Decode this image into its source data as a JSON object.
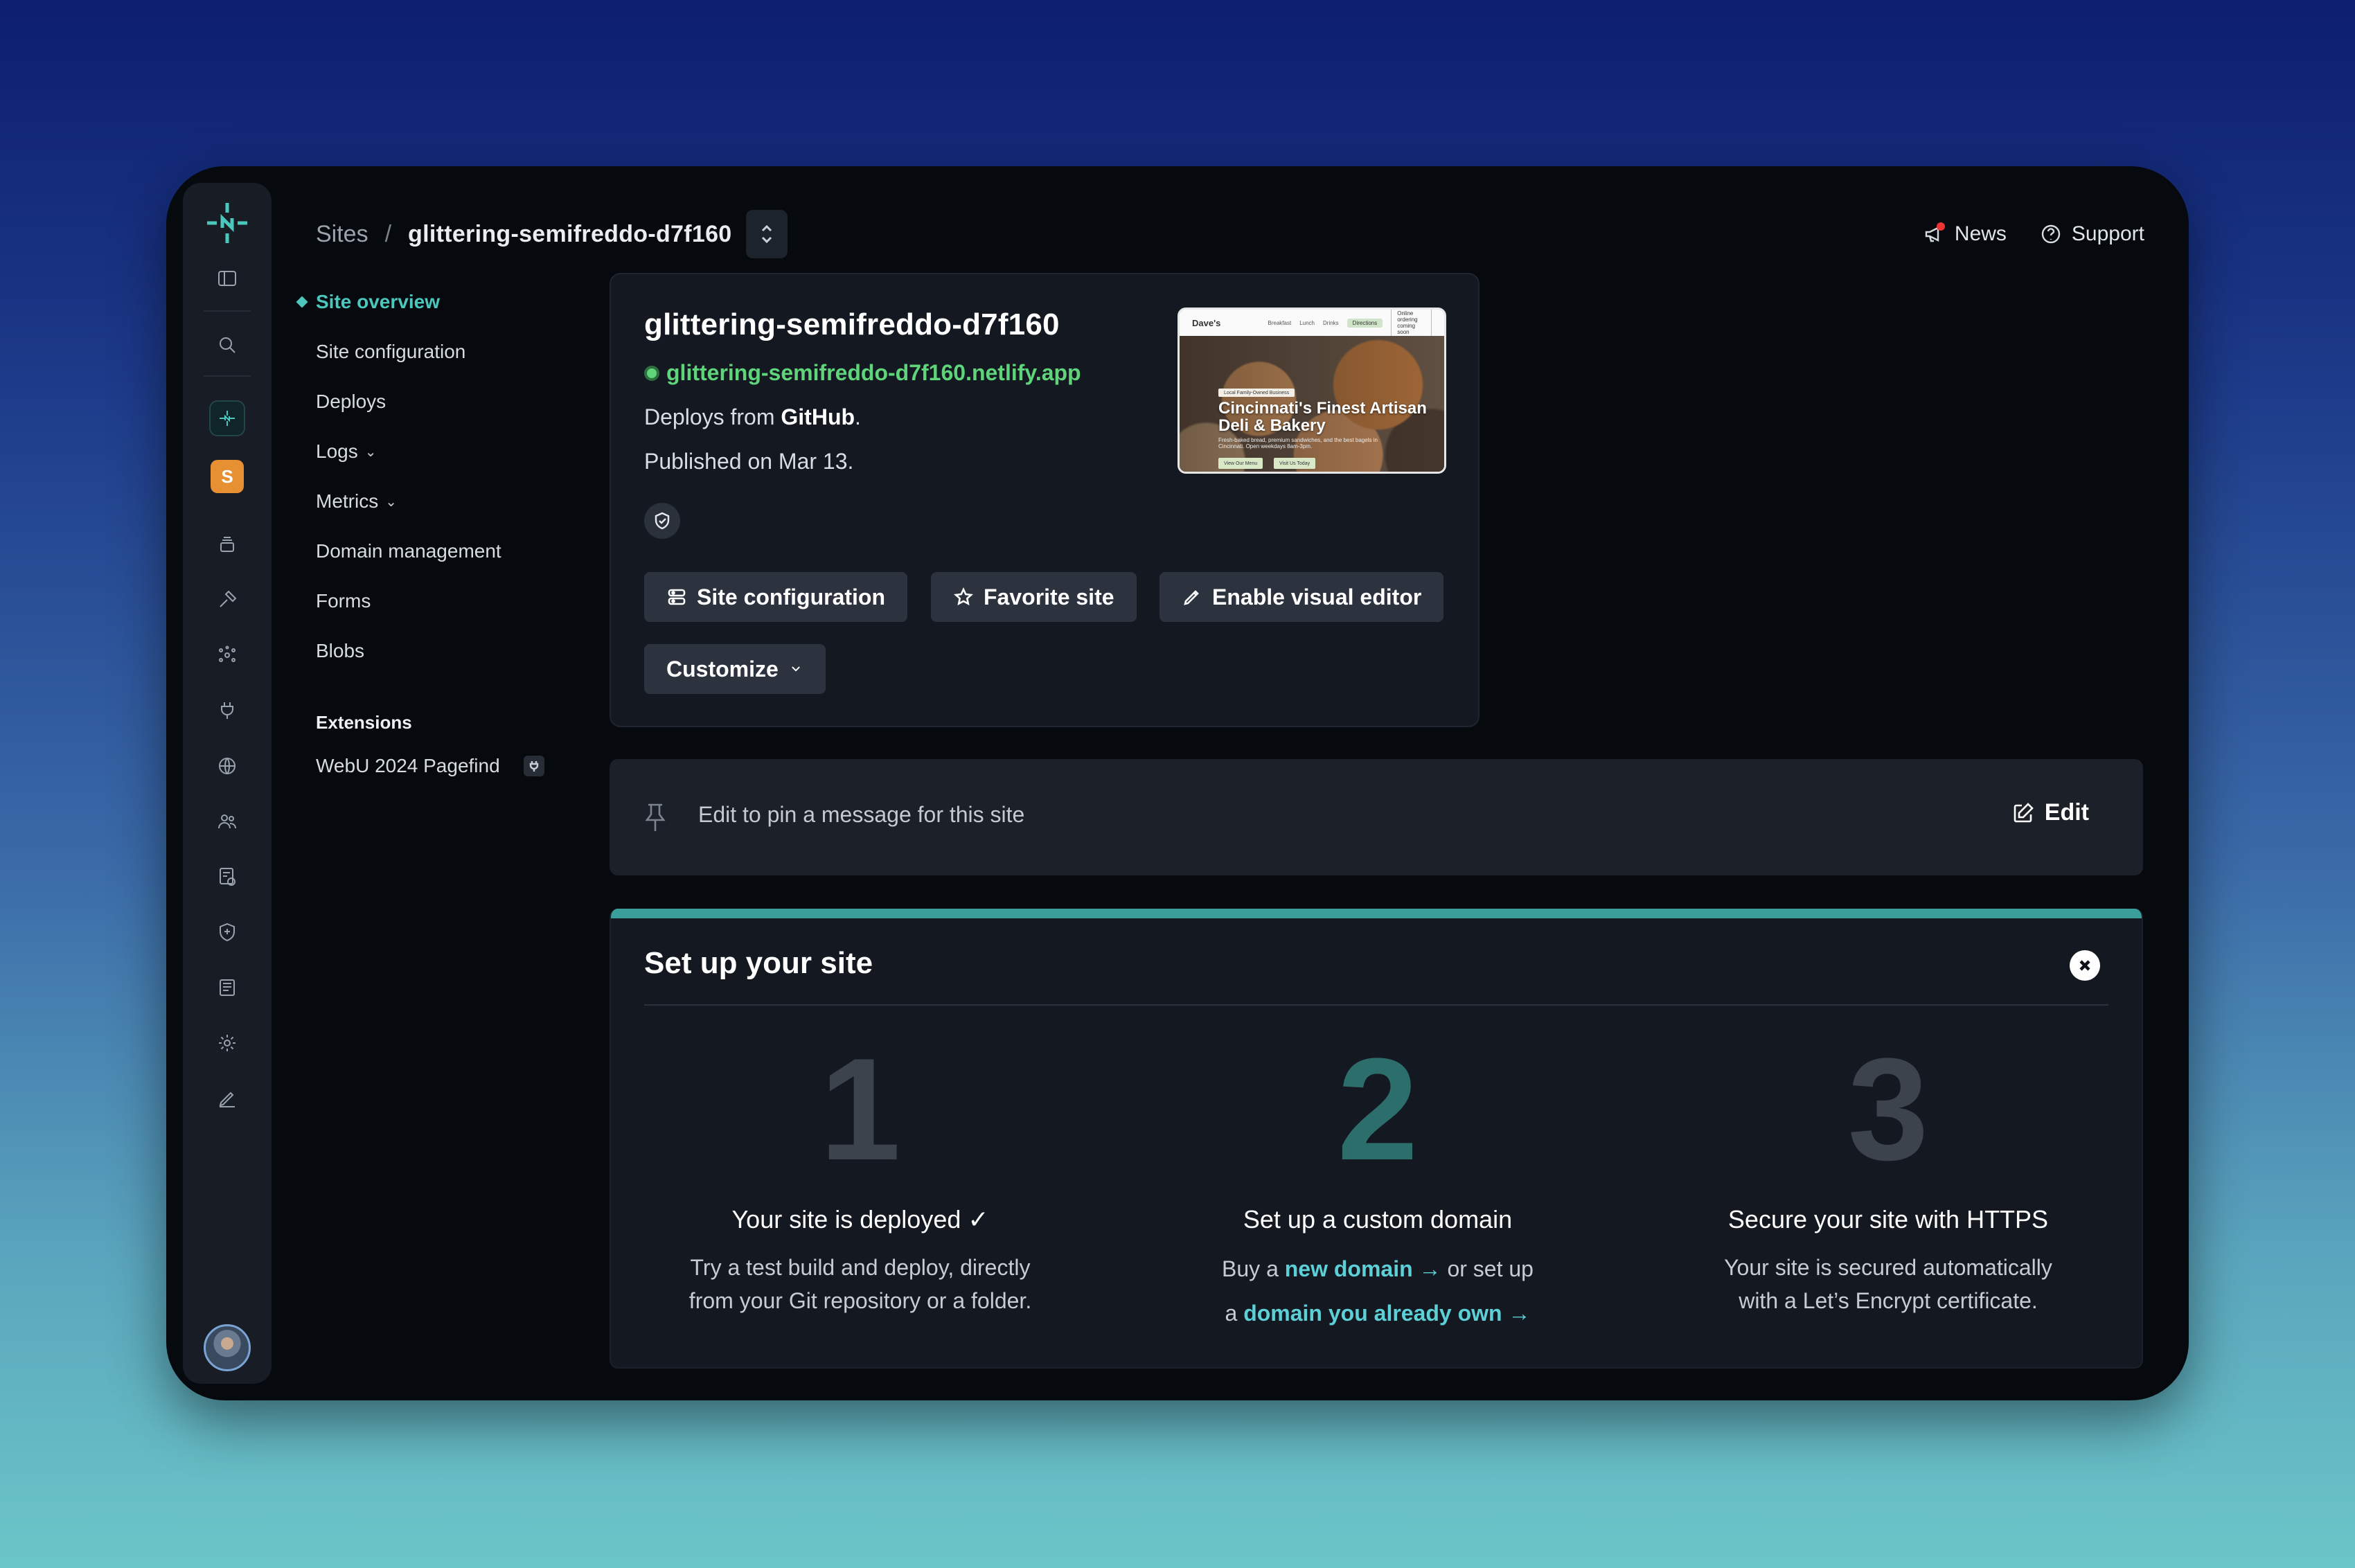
{
  "breadcrumb": {
    "root": "Sites",
    "separator": "/",
    "current": "glittering-semifreddo-d7f160"
  },
  "topbar": {
    "news_label": "News",
    "support_label": "Support"
  },
  "rail": {
    "team_initial": "S",
    "icons": [
      "netlify-logo-icon",
      "sidebar-toggle-icon",
      "search-icon",
      "projects-icon",
      "team-badge",
      "builds-icon",
      "tools-icon",
      "integrations-icon",
      "plug-icon",
      "globe-icon",
      "members-icon",
      "billing-icon",
      "security-icon",
      "docs-icon",
      "settings-icon",
      "edit-icon"
    ]
  },
  "sidenav": {
    "items": [
      {
        "label": "Site overview",
        "active": true
      },
      {
        "label": "Site configuration"
      },
      {
        "label": "Deploys"
      },
      {
        "label": "Logs",
        "has_caret": true
      },
      {
        "label": "Metrics",
        "has_caret": true
      },
      {
        "label": "Domain management"
      },
      {
        "label": "Forms"
      },
      {
        "label": "Blobs"
      }
    ],
    "extensions_heading": "Extensions",
    "extensions": [
      {
        "label": "WebU 2024 Pagefind"
      }
    ]
  },
  "site": {
    "name": "glittering-semifreddo-d7f160",
    "url": "glittering-semifreddo-d7f160.netlify.app",
    "deploys_prefix": "Deploys from ",
    "deploys_source": "GitHub",
    "deploys_suffix": ".",
    "published": "Published on Mar 13.",
    "preview": {
      "brand": "Dave's",
      "nav_links": [
        "Breakfast",
        "Lunch",
        "Drinks"
      ],
      "nav_pill": "Directions",
      "nav_pill2": "Online ordering coming soon",
      "tag": "Local Family-Owned Business",
      "title": "Cincinnati's Finest Artisan Deli & Bakery",
      "subtitle": "Fresh-baked bread, premium sandwiches, and the best bagels in Cincinnati. Open weekdays 8am-3pm.",
      "btn1": "View Our Menu",
      "btn2": "Visit Us Today"
    },
    "buttons": {
      "site_config": "Site configuration",
      "favorite": "Favorite site",
      "visual_editor": "Enable visual editor",
      "customize": "Customize"
    }
  },
  "pin": {
    "placeholder": "Edit to pin a message for this site",
    "edit_label": "Edit"
  },
  "setup": {
    "title": "Set up your site",
    "steps": [
      {
        "number": "1",
        "title": "Your site is deployed ✓",
        "desc_line1": "Try a test build and deploy, directly",
        "desc_line2": "from your Git repository or a folder."
      },
      {
        "number": "2",
        "title": "Set up a custom domain",
        "line1_prefix": "Buy a ",
        "line1_link": "new domain →",
        "line1_suffix": " or set up",
        "line2_prefix": "a ",
        "line2_link": "domain you already own →"
      },
      {
        "number": "3",
        "title": "Secure your site with HTTPS",
        "desc_line1": "Your site is secured automatically",
        "desc_line2": "with a Let’s Encrypt certificate."
      }
    ]
  },
  "colors": {
    "accent_teal": "#4cc7bd",
    "url_green": "#5fd47a",
    "link_cyan": "#5cd0d6",
    "team_orange": "#e79032"
  }
}
